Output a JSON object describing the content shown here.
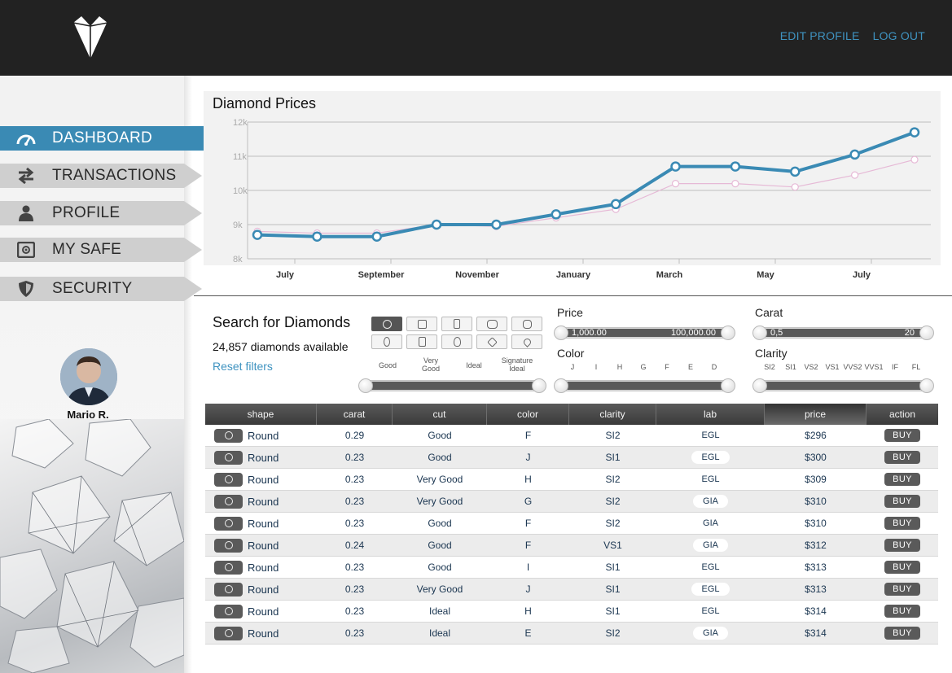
{
  "header": {
    "logo_icon": "diamond-logo-icon",
    "links": [
      "EDIT PROFILE",
      "LOG OUT"
    ]
  },
  "sidebar": {
    "items": [
      {
        "label": "DASHBOARD",
        "icon": "speedometer-icon",
        "active": true
      },
      {
        "label": "TRANSACTIONS",
        "icon": "swap-arrows-icon",
        "active": false
      },
      {
        "label": "PROFILE",
        "icon": "user-icon",
        "active": false
      },
      {
        "label": "MY SAFE",
        "icon": "safe-icon",
        "active": false
      },
      {
        "label": "SECURITY",
        "icon": "shield-icon",
        "active": false
      }
    ],
    "user": {
      "name": "Mario R."
    }
  },
  "chart": {
    "title": "Diamond Prices"
  },
  "chart_data": {
    "type": "line",
    "title": "Diamond Prices",
    "x_tick_labels": [
      "July",
      "September",
      "November",
      "January",
      "March",
      "May",
      "July"
    ],
    "y_tick_labels": [
      "12k",
      "11k",
      "10k",
      "9k",
      "8k"
    ],
    "ylim": [
      8000,
      12000
    ],
    "grid": true,
    "series": [
      {
        "values": [
          8700,
          8650,
          8650,
          9000,
          9000,
          9300,
          9600,
          10700,
          10700,
          10550,
          11050,
          11700
        ],
        "color": "#3a8ab4"
      },
      {
        "values": [
          8800,
          8750,
          8750,
          9000,
          8950,
          9200,
          9450,
          10200,
          10200,
          10100,
          10450,
          10900
        ],
        "color": "#e6b9d6"
      }
    ]
  },
  "search": {
    "title": "Search for Diamonds",
    "count": "24,857 diamonds available",
    "reset": "Reset filters",
    "shapes": [
      "round",
      "princess",
      "emerald",
      "cushion",
      "asscher",
      "oval",
      "radiant",
      "pear",
      "marquise",
      "heart"
    ],
    "cut_labels": [
      "Good",
      "Very Good",
      "Ideal",
      "Signature Ideal"
    ],
    "price": {
      "label": "Price",
      "min": "1,000.00",
      "max": "100,000.00"
    },
    "carat": {
      "label": "Carat",
      "min": "0,5",
      "max": "20"
    },
    "color": {
      "label": "Color",
      "ticks": [
        "J",
        "I",
        "H",
        "G",
        "F",
        "E",
        "D"
      ]
    },
    "clarity": {
      "label": "Clarity",
      "ticks": [
        "SI2",
        "SI1",
        "VS2",
        "VS1",
        "VVS2",
        "VVS1",
        "IF",
        "FL"
      ]
    }
  },
  "table": {
    "columns": [
      "shape",
      "carat",
      "cut",
      "color",
      "clarity",
      "lab",
      "price",
      "action"
    ],
    "buy_label": "BUY",
    "rows": [
      {
        "shape": "Round",
        "carat": "0.29",
        "cut": "Good",
        "color": "F",
        "clarity": "SI2",
        "lab": "EGL",
        "price": "$296"
      },
      {
        "shape": "Round",
        "carat": "0.23",
        "cut": "Good",
        "color": "J",
        "clarity": "SI1",
        "lab": "EGL",
        "price": "$300"
      },
      {
        "shape": "Round",
        "carat": "0.23",
        "cut": "Very Good",
        "color": "H",
        "clarity": "SI2",
        "lab": "EGL",
        "price": "$309"
      },
      {
        "shape": "Round",
        "carat": "0.23",
        "cut": "Very Good",
        "color": "G",
        "clarity": "SI2",
        "lab": "GIA",
        "price": "$310"
      },
      {
        "shape": "Round",
        "carat": "0.23",
        "cut": "Good",
        "color": "F",
        "clarity": "SI2",
        "lab": "GIA",
        "price": "$310"
      },
      {
        "shape": "Round",
        "carat": "0.24",
        "cut": "Good",
        "color": "F",
        "clarity": "VS1",
        "lab": "GIA",
        "price": "$312"
      },
      {
        "shape": "Round",
        "carat": "0.23",
        "cut": "Good",
        "color": "I",
        "clarity": "SI1",
        "lab": "EGL",
        "price": "$313"
      },
      {
        "shape": "Round",
        "carat": "0.23",
        "cut": "Very Good",
        "color": "J",
        "clarity": "SI1",
        "lab": "EGL",
        "price": "$313"
      },
      {
        "shape": "Round",
        "carat": "0.23",
        "cut": "Ideal",
        "color": "H",
        "clarity": "SI1",
        "lab": "EGL",
        "price": "$314"
      },
      {
        "shape": "Round",
        "carat": "0.23",
        "cut": "Ideal",
        "color": "E",
        "clarity": "SI2",
        "lab": "GIA",
        "price": "$314"
      }
    ]
  }
}
